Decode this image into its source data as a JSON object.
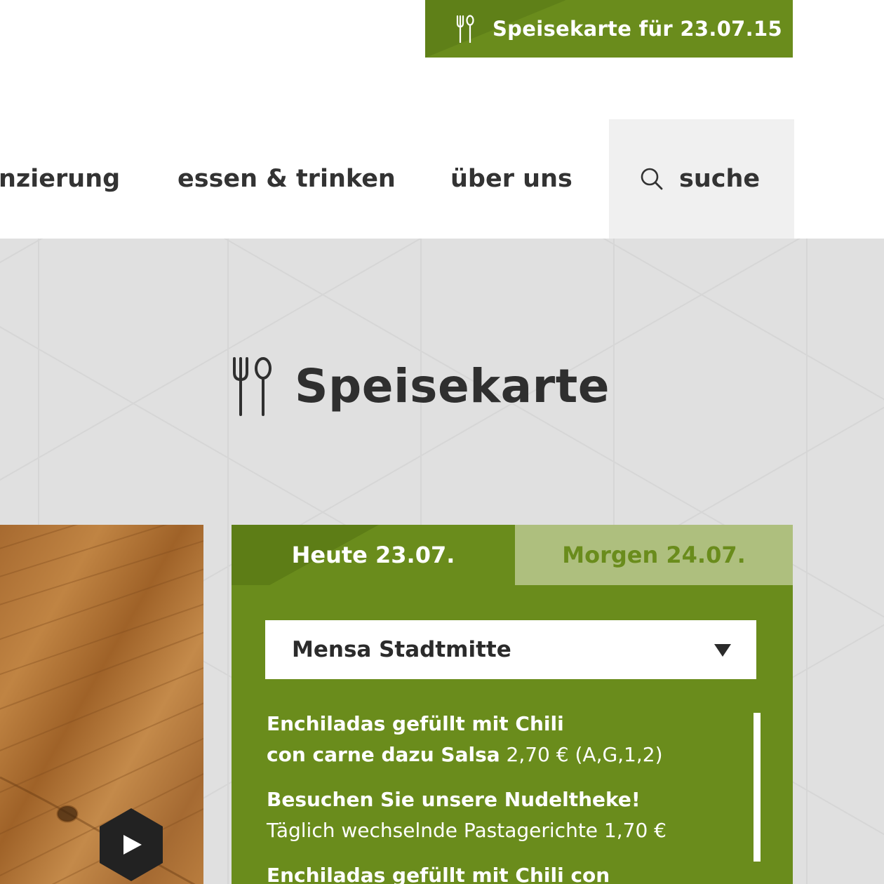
{
  "top_banner": {
    "label": "Speisekarte für 23.07.15"
  },
  "nav": {
    "items": [
      {
        "label": "nzierung"
      },
      {
        "label": "essen & trinken"
      },
      {
        "label": "über uns"
      }
    ],
    "search_label": "suche"
  },
  "page_title": "Speisekarte",
  "menu": {
    "tabs": [
      {
        "label": "Heute 23.07.",
        "active": true
      },
      {
        "label": "Morgen 24.07.",
        "active": false
      }
    ],
    "location_select": {
      "value": "Mensa Stadtmitte"
    },
    "items": [
      {
        "line1": "Enchiladas gefüllt mit Chili",
        "line2_bold": "con carne dazu Salsa",
        "line2_rest": " 2,70 € (A,G,1,2)"
      },
      {
        "line1": "Besuchen Sie unsere Nudeltheke!",
        "line2_bold": "",
        "line2_rest": "Täglich wechselnde Pastagerichte 1,70 €"
      },
      {
        "line1": "Enchiladas gefüllt mit Chili con",
        "line2_bold": "",
        "line2_rest": ""
      }
    ]
  },
  "colors": {
    "brand_green": "#6a8c1c",
    "tab_inactive": "#aebf7e",
    "hero_bg": "#e0e0e0"
  },
  "icons": [
    "fork-knife-icon",
    "search-icon",
    "chevron-down-icon",
    "play-icon"
  ]
}
